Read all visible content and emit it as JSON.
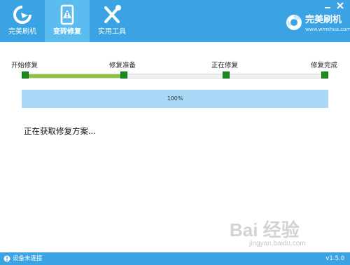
{
  "nav": {
    "tabs": [
      {
        "label": "完美刷机",
        "icon": "refresh-icon"
      },
      {
        "label": "变砖修复",
        "icon": "warning-icon"
      },
      {
        "label": "实用工具",
        "icon": "tools-icon"
      }
    ],
    "active_tab": 1
  },
  "brand": {
    "name": "完美刷机",
    "url": "www.wmshua.com",
    "icon": "chrome-logo-icon"
  },
  "window_controls": [
    "minimize-icon",
    "close-icon"
  ],
  "stages": {
    "labels": [
      "开始修复",
      "修复准备",
      "正在修复",
      "修复完成"
    ],
    "completed_fraction": 0.333
  },
  "progress": {
    "text": "100%",
    "value": 1.0
  },
  "status_text": "正在获取修复方案...",
  "statusbar": {
    "connection": "设备未连接",
    "version": "v1.5.0"
  },
  "watermark": {
    "text": "Bai 经验",
    "url": "jingyan.baidu.com"
  },
  "colors": {
    "accent": "#3aa3e3",
    "stage_done": "#8cc63f",
    "node": "#1c8a1c",
    "progress_fill": "#a9d8f7"
  }
}
